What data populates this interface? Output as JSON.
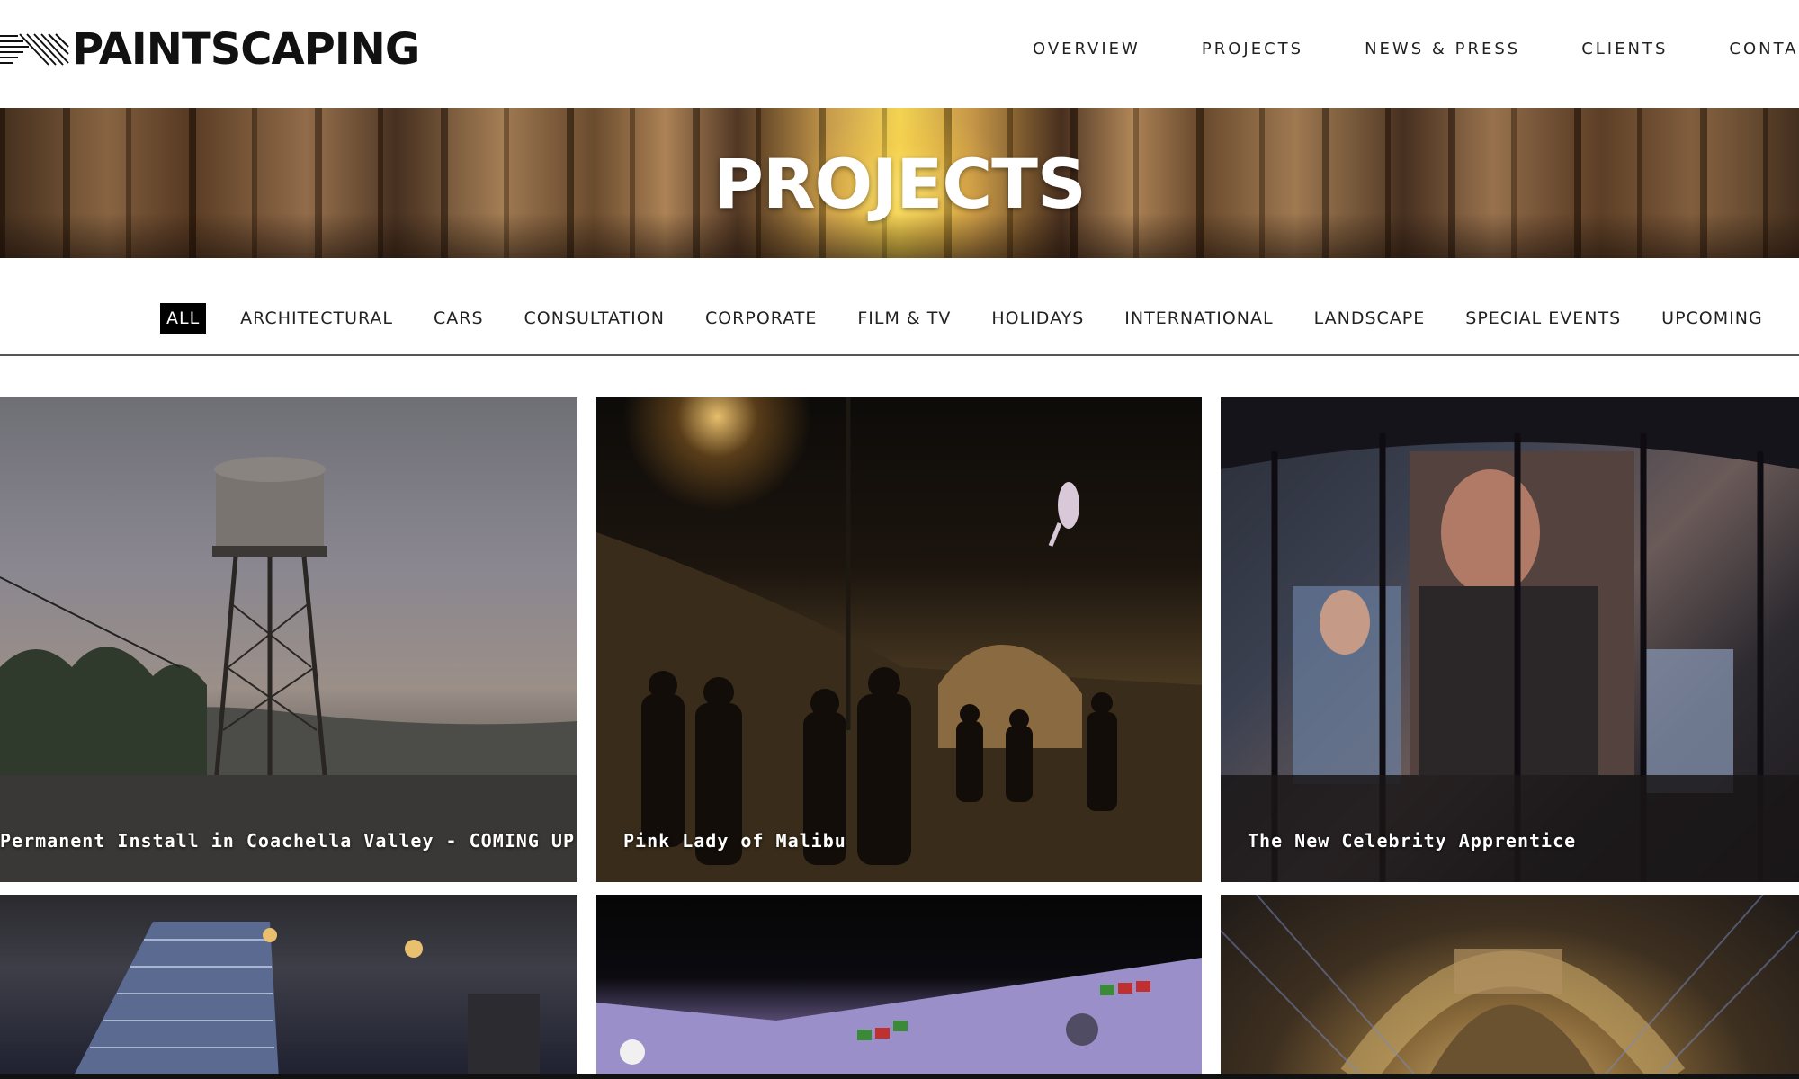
{
  "header": {
    "logo_text": "PAINTSCAPING",
    "nav": [
      "OVERVIEW",
      "PROJECTS",
      "NEWS & PRESS",
      "CLIENTS",
      "CONTA"
    ]
  },
  "banner": {
    "title": "PROJECTS"
  },
  "filters": {
    "items": [
      "ALL",
      "ARCHITECTURAL",
      "CARS",
      "CONSULTATION",
      "CORPORATE",
      "FILM & TV",
      "HOLIDAYS",
      "INTERNATIONAL",
      "LANDSCAPE",
      "SPECIAL EVENTS",
      "UPCOMING"
    ],
    "active": "ALL"
  },
  "projects": [
    {
      "title": "Permanent Install in Coachella Valley - COMING UP"
    },
    {
      "title": "Pink Lady of Malibu"
    },
    {
      "title": "The New Celebrity Apprentice"
    },
    {
      "title": ""
    },
    {
      "title": ""
    },
    {
      "title": ""
    }
  ],
  "colors": {
    "accent": "#000000",
    "text": "#222222",
    "background": "#ffffff"
  }
}
